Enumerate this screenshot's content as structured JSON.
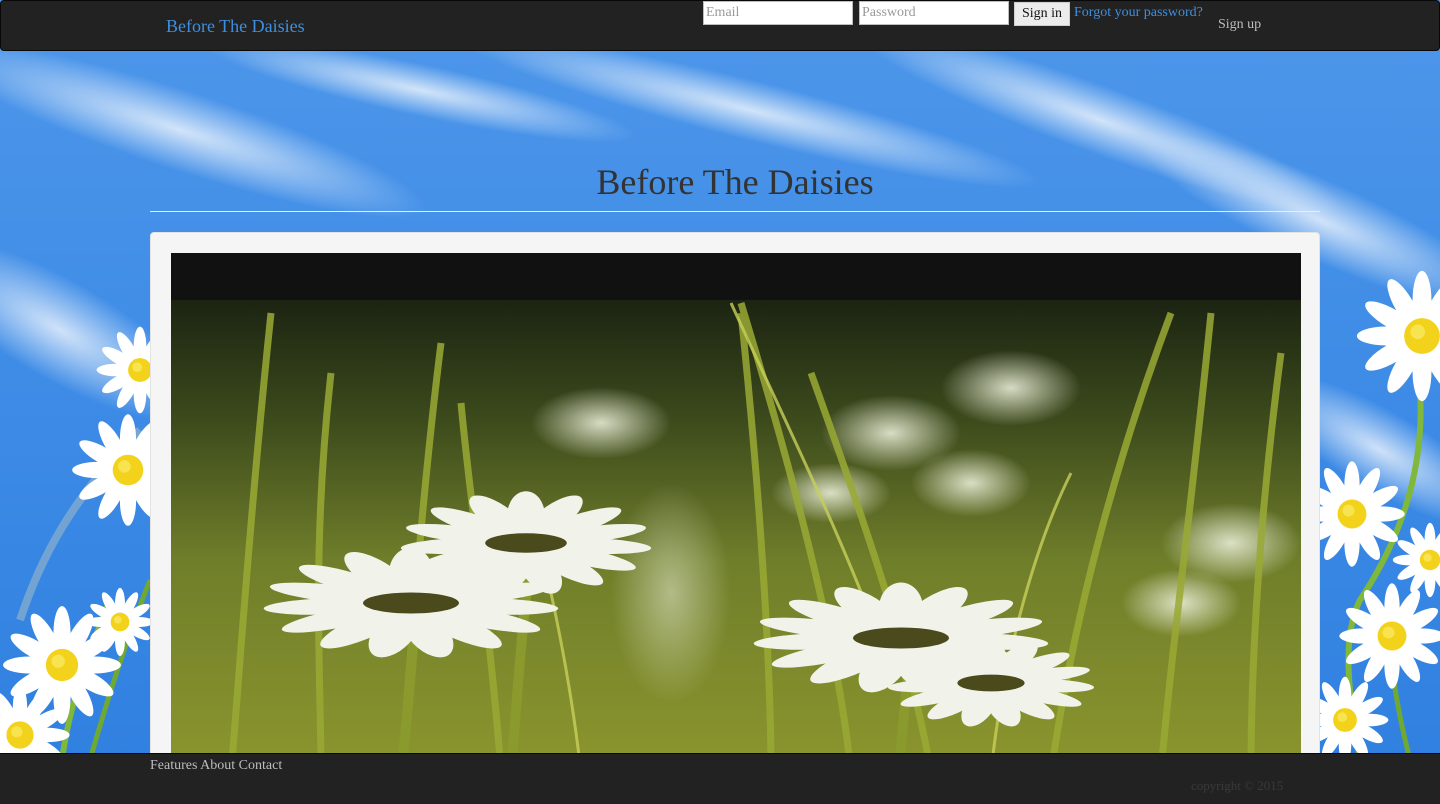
{
  "navbar": {
    "brand": "Before The Daisies",
    "email_placeholder": "Email",
    "password_placeholder": "Password",
    "signin_label": "Sign in",
    "forgot_label": "Forgot your password?",
    "signup_label": "Sign up"
  },
  "main": {
    "title": "Before The Daisies"
  },
  "footer": {
    "links": [
      "Features",
      "About",
      "Contact"
    ],
    "copyright": "copyright © 2015"
  },
  "colors": {
    "navbar_bg": "#222222",
    "link_blue": "#3d8fe0",
    "sky_blue": "#3a8ae6",
    "well_bg": "#f5f5f5"
  }
}
